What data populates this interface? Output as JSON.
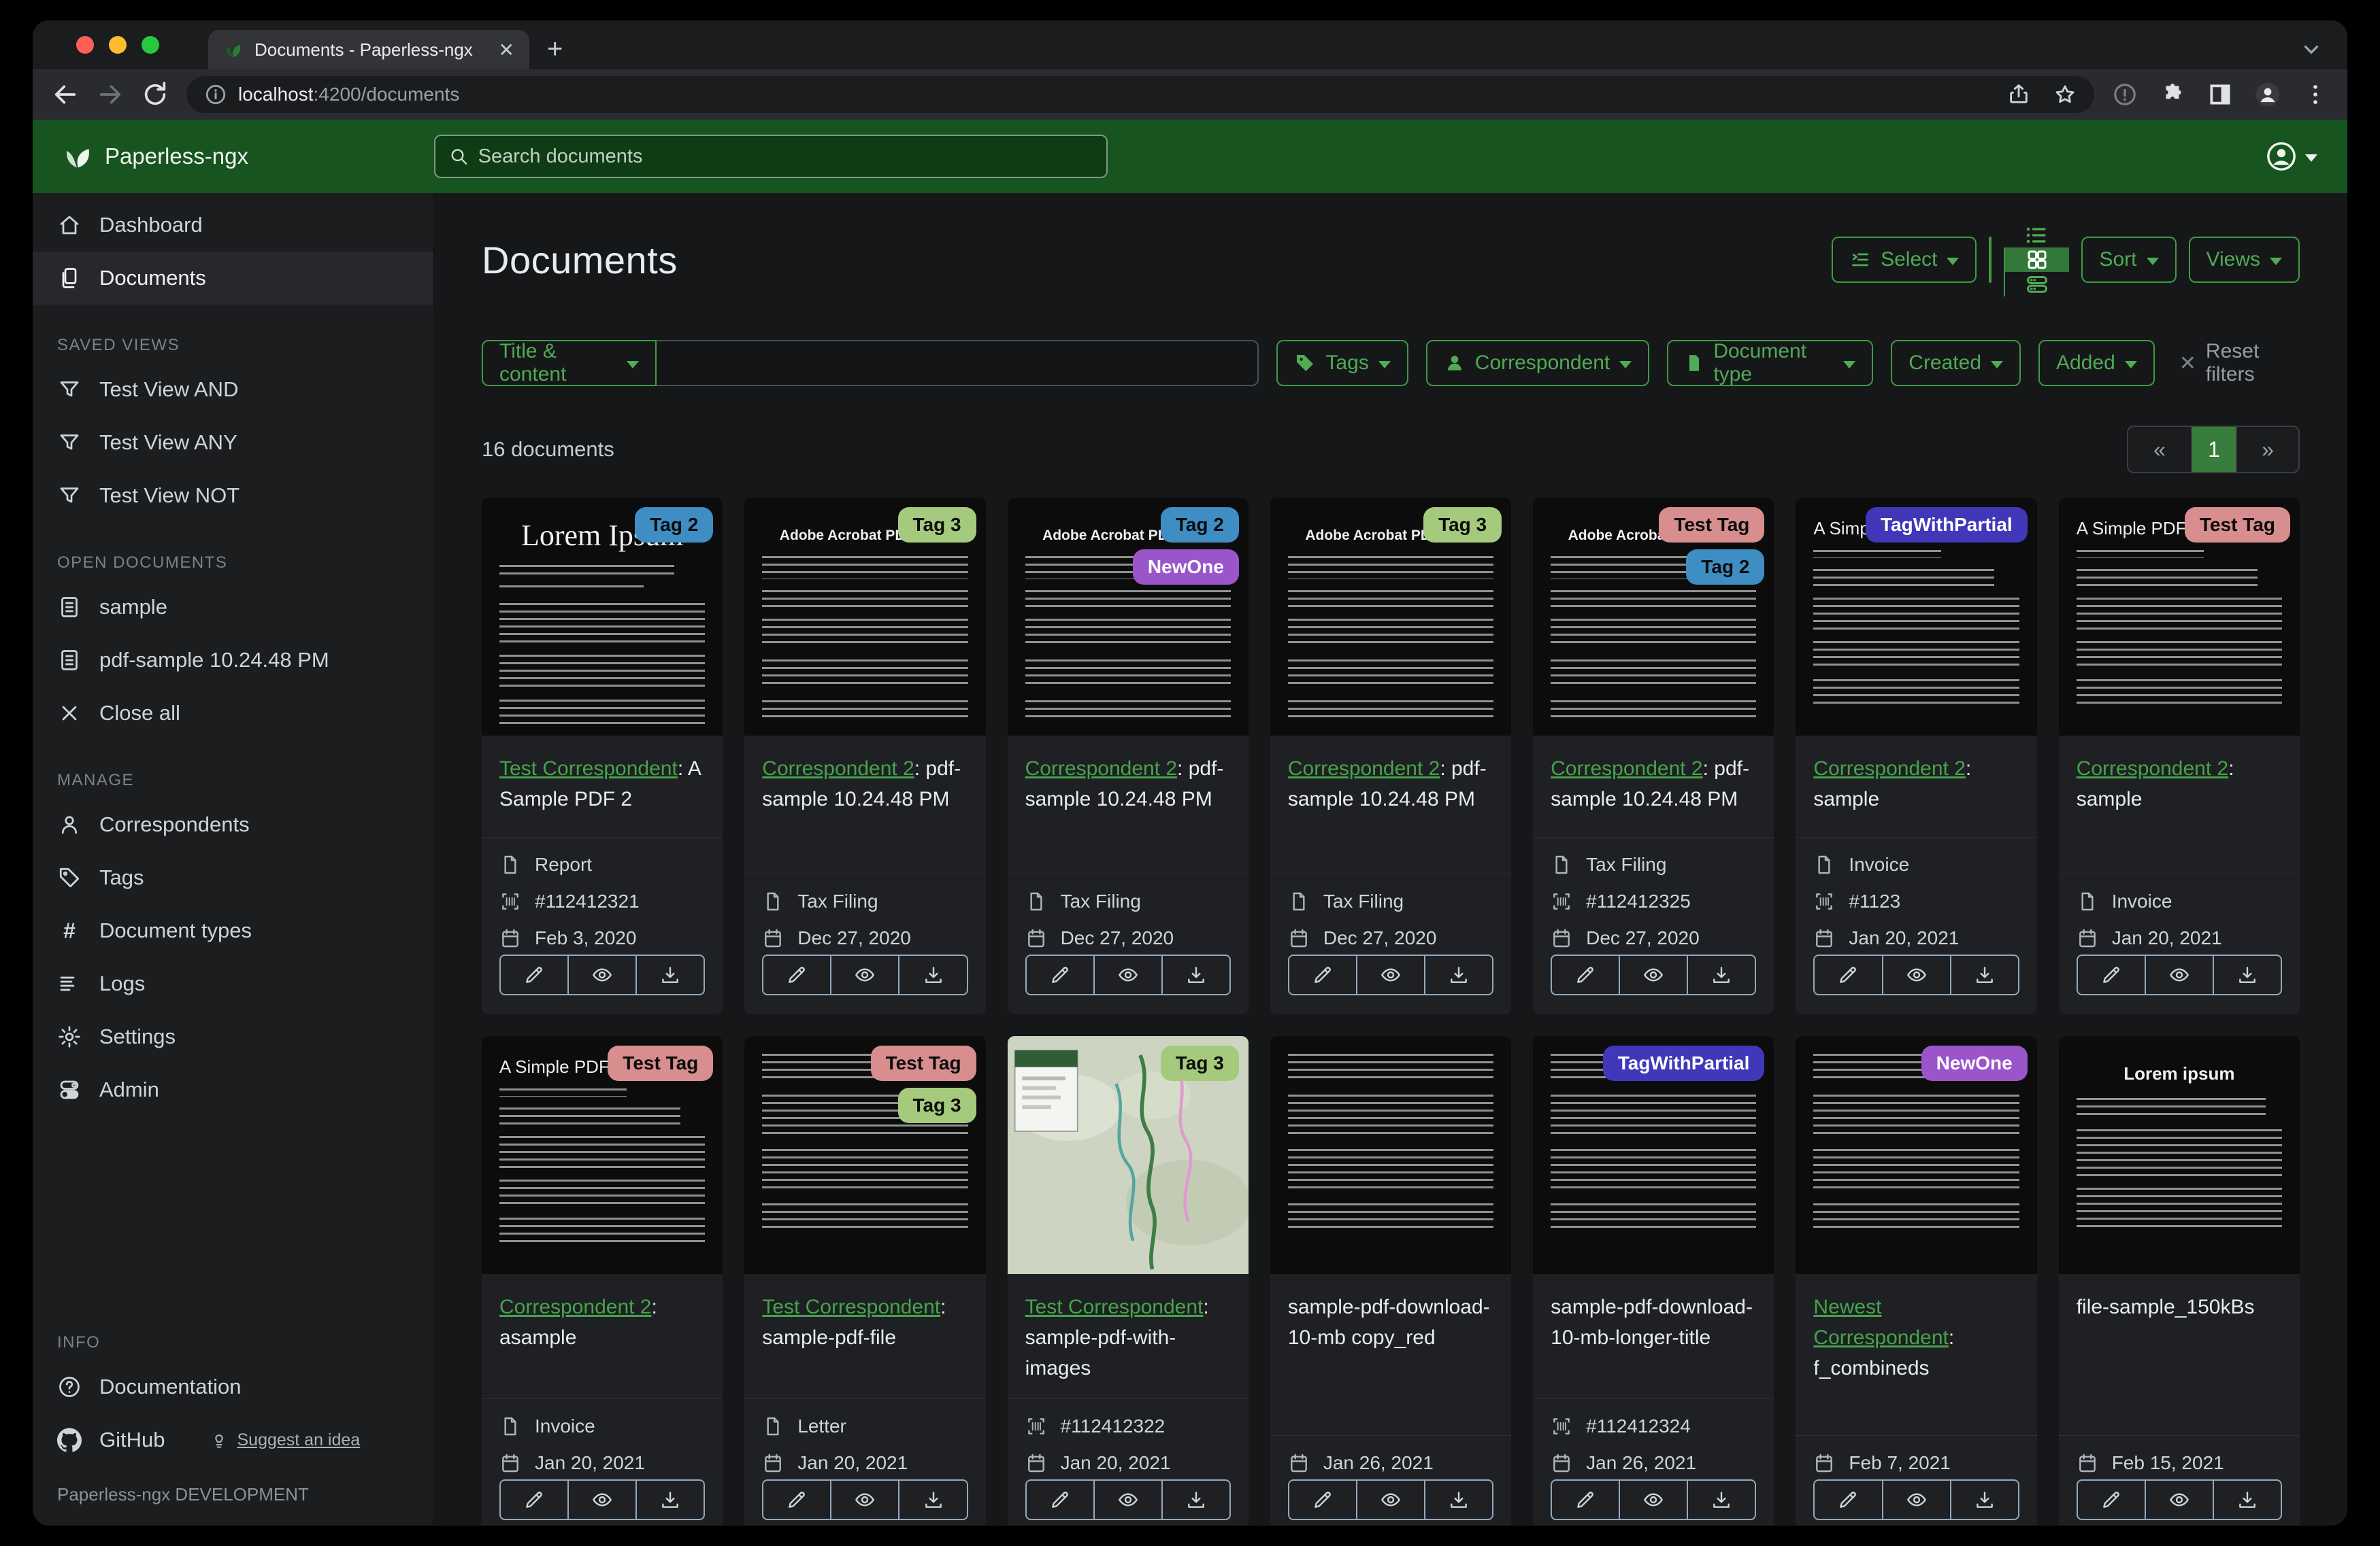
{
  "browser": {
    "tab_title": "Documents - Paperless-ngx",
    "url_host": "localhost",
    "url_rest": ":4200/documents"
  },
  "header": {
    "app_name": "Paperless-ngx",
    "search_placeholder": "Search documents"
  },
  "sidebar": {
    "sections": [
      {
        "title": "",
        "items": [
          {
            "icon": "home",
            "label": "Dashboard"
          },
          {
            "icon": "documents",
            "label": "Documents",
            "active": true
          }
        ]
      },
      {
        "title": "SAVED VIEWS",
        "items": [
          {
            "icon": "funnel",
            "label": "Test View AND"
          },
          {
            "icon": "funnel",
            "label": "Test View ANY"
          },
          {
            "icon": "funnel",
            "label": "Test View NOT"
          }
        ]
      },
      {
        "title": "OPEN DOCUMENTS",
        "items": [
          {
            "icon": "filetext",
            "label": "sample"
          },
          {
            "icon": "filetext",
            "label": "pdf-sample 10.24.48 PM"
          },
          {
            "icon": "close",
            "label": "Close all"
          }
        ]
      },
      {
        "title": "MANAGE",
        "items": [
          {
            "icon": "person",
            "label": "Correspondents"
          },
          {
            "icon": "tag",
            "label": "Tags"
          },
          {
            "icon": "hash",
            "label": "Document types"
          },
          {
            "icon": "logs",
            "label": "Logs"
          },
          {
            "icon": "gear",
            "label": "Settings"
          },
          {
            "icon": "admin",
            "label": "Admin"
          }
        ]
      },
      {
        "title": "INFO",
        "items": [
          {
            "icon": "question",
            "label": "Documentation"
          },
          {
            "icon": "github",
            "label": "GitHub",
            "extra": {
              "icon": "bulb",
              "label": "Suggest an idea"
            }
          }
        ]
      }
    ],
    "footer": "Paperless-ngx DEVELOPMENT"
  },
  "page": {
    "title": "Documents",
    "select_label": "Select",
    "sort_label": "Sort",
    "views_label": "Views"
  },
  "filters": {
    "field_label": "Title & content",
    "input_value": "",
    "tags_label": "Tags",
    "correspondent_label": "Correspondent",
    "document_type_label": "Document type",
    "created_label": "Created",
    "added_label": "Added",
    "reset_label": "Reset filters"
  },
  "results": {
    "count_text": "16 documents",
    "pager": {
      "prev": "«",
      "page": "1",
      "next": "»"
    }
  },
  "colors": {
    "accent_green": "#3e9a43",
    "header_green": "#17541f",
    "link_green": "#45a44b"
  },
  "tag_styles": {
    "Tag 2": {
      "bg": "#3e8ec4",
      "fg": "#0b0b0b"
    },
    "Tag 3": {
      "bg": "#a6ca7d",
      "fg": "#0b0b0b"
    },
    "NewOne": {
      "bg": "#9a55cb",
      "fg": "#ffffff"
    },
    "TagWithPartial": {
      "bg": "#4038b8",
      "fg": "#ffffff"
    },
    "Test Tag": {
      "bg": "#d88e8e",
      "fg": "#0b0b0b"
    }
  },
  "cards": [
    {
      "tags": [
        "Tag 2"
      ],
      "thumb": "lorem-serif",
      "thumb_heading": "Lorem Ipsum",
      "correspondent": "Test Correspondent",
      "title": ": A Sample PDF 2",
      "type": "Report",
      "asn": "#112412321",
      "date": "Feb 3, 2020"
    },
    {
      "tags": [
        "Tag 3"
      ],
      "thumb": "acrobat",
      "thumb_heading": "Adobe Acrobat PDF Files",
      "correspondent": "Correspondent 2",
      "title": ": pdf-sample 10.24.48 PM",
      "type": "Tax Filing",
      "asn": null,
      "date": "Dec 27, 2020"
    },
    {
      "tags": [
        "Tag 2",
        "NewOne"
      ],
      "thumb": "acrobat",
      "thumb_heading": "Adobe Acrobat PDF Files",
      "correspondent": "Correspondent 2",
      "title": ": pdf-sample 10.24.48 PM",
      "type": "Tax Filing",
      "asn": null,
      "date": "Dec 27, 2020"
    },
    {
      "tags": [
        "Tag 3"
      ],
      "thumb": "acrobat",
      "thumb_heading": "Adobe Acrobat PDF Files",
      "correspondent": "Correspondent 2",
      "title": ": pdf-sample 10.24.48 PM",
      "type": "Tax Filing",
      "asn": null,
      "date": "Dec 27, 2020"
    },
    {
      "tags": [
        "Test Tag",
        "Tag 2"
      ],
      "thumb": "acrobat",
      "thumb_heading": "Adobe Acrobat PDF Files",
      "correspondent": "Correspondent 2",
      "title": ": pdf-sample 10.24.48 PM",
      "type": "Tax Filing",
      "asn": "#112412325",
      "date": "Dec 27, 2020"
    },
    {
      "tags": [
        "TagWithPartial"
      ],
      "thumb": "simple",
      "thumb_heading": "A Simple PDF File",
      "correspondent": "Correspondent 2",
      "title": ": sample",
      "type": "Invoice",
      "asn": "#1123",
      "date": "Jan 20, 2021"
    },
    {
      "tags": [
        "Test Tag"
      ],
      "thumb": "simple",
      "thumb_heading": "A Simple PDF File",
      "correspondent": "Correspondent 2",
      "title": ": sample",
      "type": "Invoice",
      "asn": null,
      "date": "Jan 20, 2021"
    },
    {
      "tags": [
        "Test Tag"
      ],
      "thumb": "simple",
      "thumb_heading": "A Simple PDF File",
      "correspondent": "Correspondent 2",
      "title": ": asample",
      "type": "Invoice",
      "asn": null,
      "date": "Jan 20, 2021"
    },
    {
      "tags": [
        "Test Tag",
        "Tag 3"
      ],
      "thumb": "text",
      "thumb_heading": "",
      "correspondent": "Test Correspondent",
      "title": ": sample-pdf-file",
      "type": "Letter",
      "asn": null,
      "date": "Jan 20, 2021"
    },
    {
      "tags": [
        "Tag 3"
      ],
      "thumb": "map",
      "thumb_heading": "",
      "correspondent": "Test Correspondent",
      "title": ": sample-pdf-with-images",
      "type": null,
      "asn": "#112412322",
      "date": "Jan 20, 2021"
    },
    {
      "tags": [],
      "thumb": "text",
      "thumb_heading": "",
      "correspondent": null,
      "title": "sample-pdf-download-10-mb copy_red",
      "type": null,
      "asn": null,
      "date": "Jan 26, 2021"
    },
    {
      "tags": [
        "TagWithPartial"
      ],
      "thumb": "text",
      "thumb_heading": "",
      "correspondent": null,
      "title": "sample-pdf-download-10-mb-longer-title",
      "type": null,
      "asn": "#112412324",
      "date": "Jan 26, 2021"
    },
    {
      "tags": [
        "NewOne"
      ],
      "thumb": "text",
      "thumb_heading": "",
      "correspondent": "Newest Correspondent",
      "title": ": f_combineds",
      "type": null,
      "asn": null,
      "date": "Feb 7, 2021"
    },
    {
      "tags": [],
      "thumb": "lorem-center",
      "thumb_heading": "Lorem ipsum",
      "correspondent": null,
      "title": "file-sample_150kBs",
      "type": null,
      "asn": null,
      "date": "Feb 15, 2021"
    }
  ]
}
